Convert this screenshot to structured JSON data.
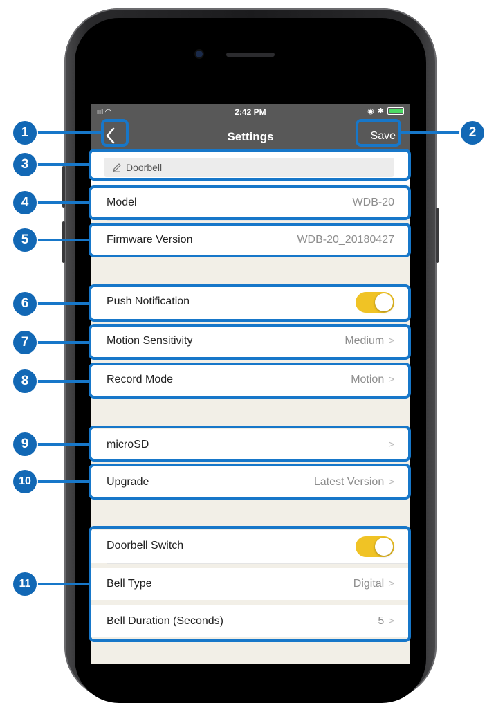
{
  "status_bar": {
    "time": "2:42 PM",
    "signal": "ııl",
    "bluetooth": "✱"
  },
  "nav": {
    "title": "Settings",
    "save_label": "Save",
    "back_icon": "chevron-left-icon"
  },
  "device_name": {
    "value": "Doorbell",
    "icon": "pencil-icon"
  },
  "rows": {
    "model": {
      "label": "Model",
      "value": "WDB-20"
    },
    "firmware": {
      "label": "Firmware Version",
      "value": "WDB-20_20180427"
    },
    "push": {
      "label": "Push Notification",
      "enabled": true
    },
    "motion": {
      "label": "Motion Sensitivity",
      "value": "Medium"
    },
    "record": {
      "label": "Record Mode",
      "value": "Motion"
    },
    "microsd": {
      "label": "microSD",
      "value": ""
    },
    "upgrade": {
      "label": "Upgrade",
      "value": "Latest Version"
    },
    "doorbell_switch": {
      "label": "Doorbell Switch",
      "enabled": true
    },
    "bell_type": {
      "label": "Bell Type",
      "value": "Digital"
    },
    "bell_duration": {
      "label": "Bell Duration (Seconds)",
      "value": "5"
    }
  },
  "chevron": ">",
  "callouts": [
    "1",
    "2",
    "3",
    "4",
    "5",
    "6",
    "7",
    "8",
    "9",
    "10",
    "11"
  ],
  "colors": {
    "accent": "#1777c9",
    "marker": "#1268b5",
    "toggle_on": "#f0c325",
    "nav_bg": "#585858",
    "screen_bg": "#f2efe7"
  }
}
